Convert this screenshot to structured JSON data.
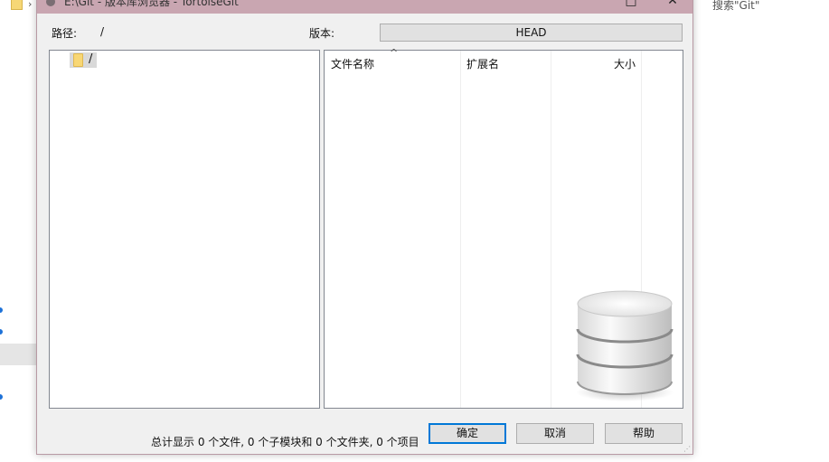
{
  "background": {
    "search_text": "搜索\"Git\"",
    "chevron": "›"
  },
  "window": {
    "title": "E:\\Git - 版本库浏览器 - TortoiseGit",
    "minimize": "□",
    "close": "✕"
  },
  "path": {
    "label": "路径:",
    "value": "/"
  },
  "revision": {
    "label": "版本:",
    "value": "HEAD"
  },
  "tree": {
    "items": [
      {
        "label": "/",
        "icon": "folder-icon"
      }
    ]
  },
  "file_list": {
    "columns": [
      "文件名称",
      "扩展名",
      "大小"
    ],
    "sort_indicator": "^",
    "rows": []
  },
  "status": {
    "summary": "总计显示 0 个文件, 0 个子模块和 0 个文件夹, 0 个项目"
  },
  "buttons": {
    "ok": "确定",
    "cancel": "取消",
    "help": "帮助"
  },
  "colors": {
    "titlebar": "#c9a6b1",
    "dialog_bg": "#f0f0f0",
    "default_button_border": "#0078d7",
    "folder": "#f8d775"
  }
}
